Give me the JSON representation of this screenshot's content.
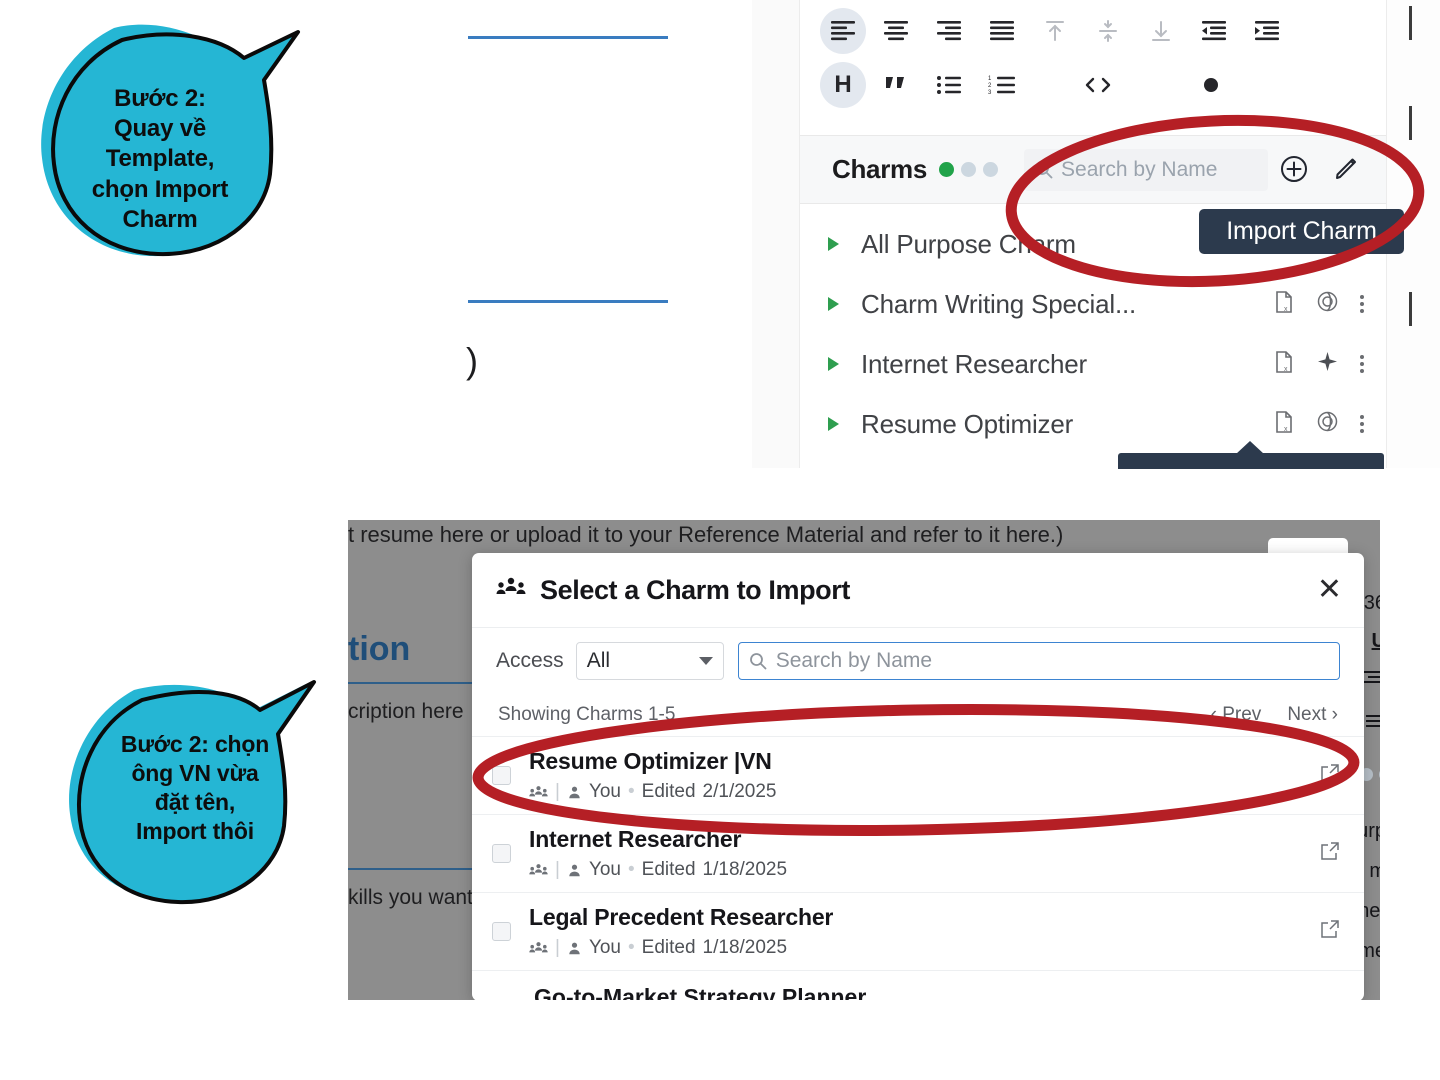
{
  "top_panel": {
    "toolbar": {
      "row1": [
        {
          "name": "align-left-icon",
          "active": true
        },
        {
          "name": "align-center-icon",
          "active": false
        },
        {
          "name": "align-right-icon",
          "active": false
        },
        {
          "name": "align-justify-icon",
          "active": false
        },
        {
          "name": "align-top-icon",
          "active": false
        },
        {
          "name": "align-middle-icon",
          "active": false
        },
        {
          "name": "align-bottom-icon",
          "active": false
        },
        {
          "name": "outdent-icon",
          "active": false
        },
        {
          "name": "indent-icon",
          "active": false
        }
      ],
      "row2": [
        {
          "name": "heading-icon",
          "label": "H",
          "active": true
        },
        {
          "name": "quote-icon",
          "active": false
        },
        {
          "name": "bullet-list-icon",
          "active": false
        },
        {
          "name": "numbered-list-icon",
          "active": false
        },
        {
          "name": "code-icon",
          "active": false
        },
        {
          "name": "bullet-dot-icon",
          "active": false
        }
      ]
    },
    "charms_header": {
      "title": "Charms",
      "status_dots": [
        "#21a34a",
        "#ccd7e0",
        "#ccd7e0"
      ],
      "search_placeholder": "Search by Name",
      "add_icon": "plus-circle-icon",
      "edit_icon": "pencil-icon"
    },
    "charm_items": [
      {
        "name": "All Purpose Charm",
        "provider_icon": "openai-icon"
      },
      {
        "name": "Charm Writing Special...",
        "provider_icon": "openai-icon"
      },
      {
        "name": "Internet Researcher",
        "provider_icon": "sparkle-icon"
      },
      {
        "name": "Resume Optimizer",
        "provider_icon": "openai-icon"
      }
    ],
    "tooltip": "Import Charm"
  },
  "doc_fragment": {
    "paren": ")"
  },
  "bottom_panel": {
    "background": {
      "top_text": "t resume here or upload it to your Reference Material and refer to it here.)",
      "heading": "tion",
      "sub1": "cription here",
      "sub2": "kills you want",
      "right_col": [
        "36",
        "U",
        "urp",
        "m ",
        "net",
        "me"
      ]
    },
    "modal": {
      "icon": "group-icon",
      "title": "Select a Charm to Import",
      "close_icon": "close-icon",
      "access_label": "Access",
      "access_value": "All",
      "access_options": [
        "All"
      ],
      "search_placeholder": "Search by Name",
      "showing_text": "Showing Charms 1-5",
      "prev_label": "‹ Prev",
      "next_label": "Next ›",
      "rows": [
        {
          "title": "Resume Optimizer |VN",
          "owner": "You",
          "separator": "•",
          "edited_label": "Edited",
          "edited_date": "2/1/2025",
          "open_icon": "external-link-icon"
        },
        {
          "title": "Internet Researcher",
          "owner": "You",
          "separator": "•",
          "edited_label": "Edited",
          "edited_date": "1/18/2025",
          "open_icon": "external-link-icon"
        },
        {
          "title": "Legal Precedent Researcher",
          "owner": "You",
          "separator": "•",
          "edited_label": "Edited",
          "edited_date": "1/18/2025",
          "open_icon": "external-link-icon"
        }
      ],
      "partial_row_title": "Go-to-Market Strategy Planner"
    }
  },
  "annotations": {
    "bubble1": "Bước 2:\nQuay về\nTemplate,\nchọn Import\nCharm",
    "bubble2": "Bước 2: chọn\nông VN vừa\nđặt tên,\nImport thôi",
    "bubble_color": "#25b6d4",
    "highlight_color": "#b51f25"
  }
}
